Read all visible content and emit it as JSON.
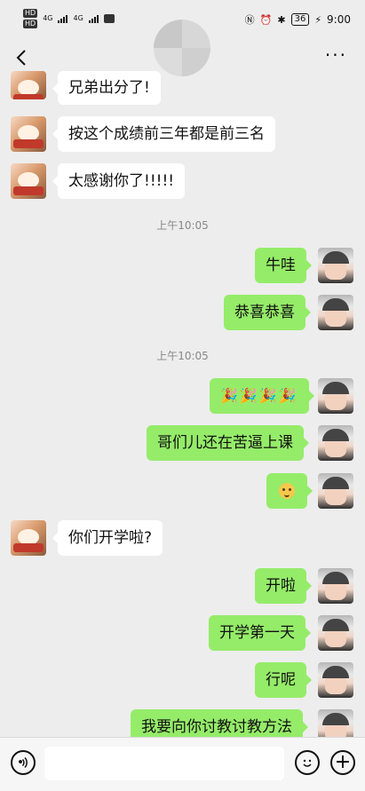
{
  "statusbar": {
    "time": "9:00",
    "battery": "36",
    "network_1": "4G",
    "network_2": "4G",
    "hd1": "HD",
    "hd2": "HD"
  },
  "header": {
    "more": "···"
  },
  "messages": [
    {
      "side": "left",
      "text": "兄弟出分了!"
    },
    {
      "side": "left",
      "text": "按这个成绩前三年都是前三名"
    },
    {
      "side": "left",
      "text": "太感谢你了!!!!!"
    },
    {
      "side": "time",
      "text": "上午10:05"
    },
    {
      "side": "right",
      "text": "牛哇"
    },
    {
      "side": "right",
      "text": "恭喜恭喜"
    },
    {
      "side": "time",
      "text": "上午10:05"
    },
    {
      "side": "right",
      "text": "🎉🎉🎉🎉",
      "kind": "party-emojis"
    },
    {
      "side": "right",
      "text": "哥们儿还在苦逼上课"
    },
    {
      "side": "right",
      "text": "",
      "kind": "smile-emoji"
    },
    {
      "side": "left",
      "text": "你们开学啦?"
    },
    {
      "side": "right",
      "text": "开啦"
    },
    {
      "side": "right",
      "text": "开学第一天"
    },
    {
      "side": "right",
      "text": "行呢"
    },
    {
      "side": "right",
      "text": "我要向你讨教讨教方法"
    }
  ],
  "icons": {
    "back": "back-chevron-icon",
    "voice": "voice-input-icon",
    "emoji": "emoji-icon",
    "plus": "plus-icon"
  },
  "colors": {
    "bubble_left": "#ffffff",
    "bubble_right": "#95ec69",
    "background": "#ededed"
  }
}
